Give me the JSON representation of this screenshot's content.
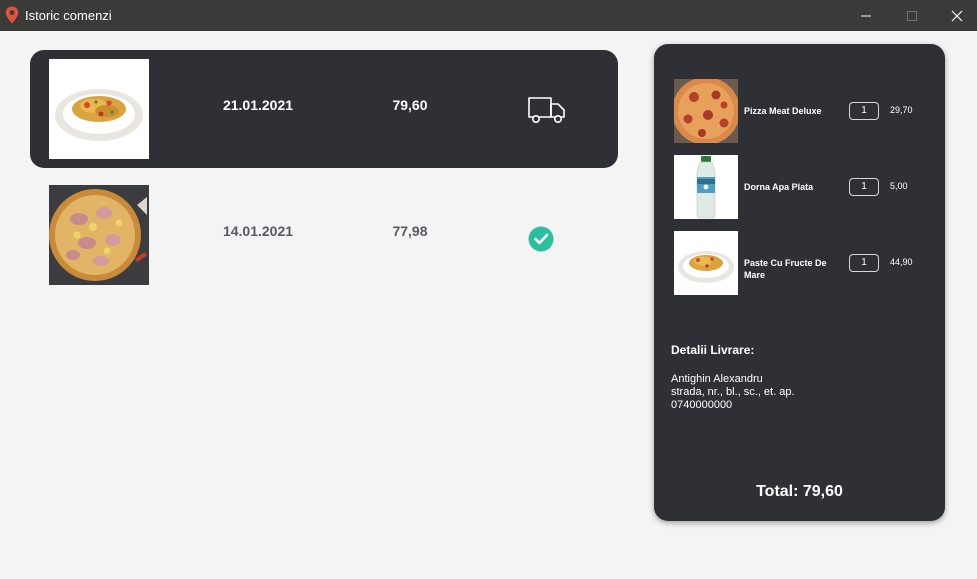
{
  "window": {
    "title": "Istoric comenzi",
    "icons": {
      "app": "location-pin-icon",
      "minimize": "minimize-icon",
      "maximize": "maximize-icon",
      "close": "close-icon"
    }
  },
  "orders": [
    {
      "date": "21.01.2021",
      "price": "79,60",
      "status": "delivery",
      "status_icon": "delivery-truck-icon",
      "image": "pasta-image",
      "selected": true
    },
    {
      "date": "14.01.2021",
      "price": "77,98",
      "status": "completed",
      "status_icon": "check-circle-icon",
      "image": "pizza-image",
      "selected": false
    }
  ],
  "details": {
    "items": [
      {
        "name": "Pizza Meat Deluxe",
        "qty": "1",
        "price": "29,70",
        "image": "pizza-image"
      },
      {
        "name": "Dorna Apa Plata",
        "qty": "1",
        "price": "5,00",
        "image": "water-bottle-image"
      },
      {
        "name": "Paste Cu Fructe De Mare",
        "qty": "1",
        "price": "44,90",
        "image": "pasta-image"
      }
    ],
    "delivery_title": "Detalii Livrare:",
    "delivery_name": "Antighin Alexandru",
    "delivery_address": "strada, nr., bl., sc., et. ap.",
    "delivery_phone": "0740000000",
    "total": "Total: 79,60"
  },
  "colors": {
    "accent_check": "#2bbfa0",
    "dark_panel": "#2f3035",
    "pin": "#e0533d"
  }
}
